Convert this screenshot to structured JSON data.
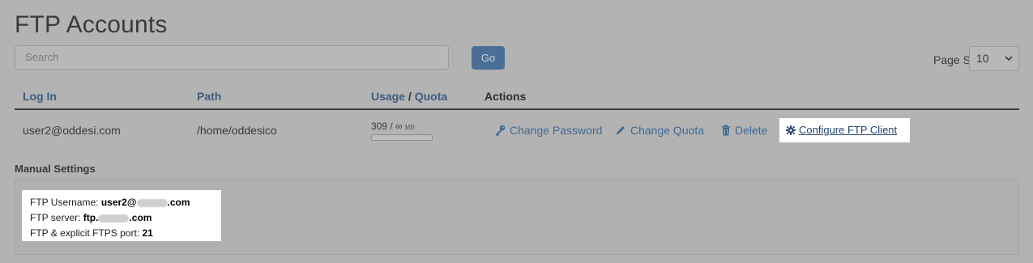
{
  "page": {
    "title": "FTP Accounts"
  },
  "search": {
    "placeholder": "Search",
    "go_label": "Go"
  },
  "pagination": {
    "label": "Page Size",
    "selected": "10"
  },
  "table": {
    "headers": {
      "login": "Log In",
      "path": "Path",
      "usage": "Usage",
      "usage_sep": " / ",
      "quota": "Quota",
      "actions": "Actions"
    },
    "rows": [
      {
        "login": "user2@oddesi.com",
        "path": "/home/oddesico",
        "usage_value": "309 / ∞",
        "usage_unit": "MB",
        "usage_fraction": 0,
        "actions": {
          "change_password": "Change Password",
          "change_quota": "Change Quota",
          "delete": "Delete",
          "configure": "Configure FTP Client"
        }
      }
    ]
  },
  "manual": {
    "label": "Manual Settings",
    "username_label": "FTP Username: ",
    "username_prefix": "user2@",
    "username_suffix": ".com",
    "server_label": "FTP server: ",
    "server_prefix": "ftp.",
    "server_suffix": ".com",
    "port_label": "FTP & explicit FTPS port: ",
    "port_value": "21"
  },
  "icons": {
    "change_password": "key-icon",
    "change_quota": "pencil-icon",
    "delete": "trash-icon",
    "configure": "gear-icon",
    "page_size": "chevron-down-icon"
  },
  "colors": {
    "link": "#3f6a92",
    "go_button": "#4a6f96",
    "background": "#b3b3b3"
  }
}
